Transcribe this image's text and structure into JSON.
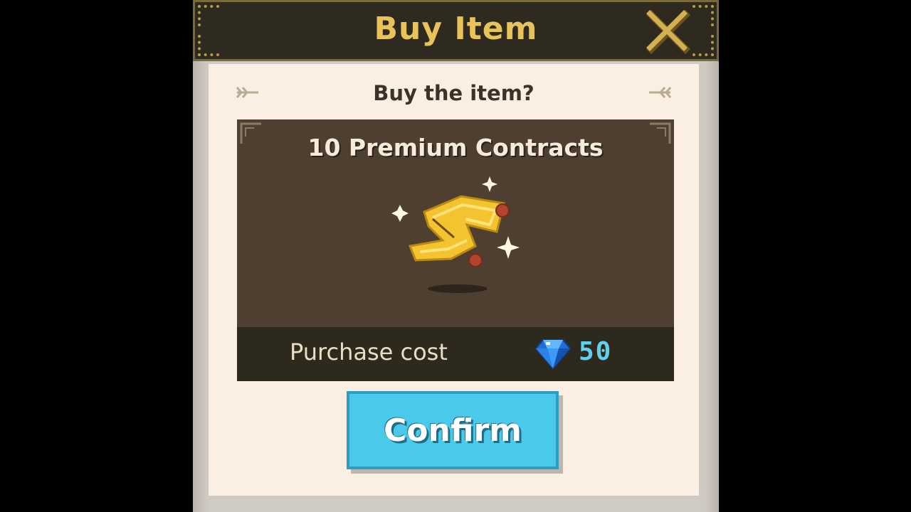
{
  "dialog": {
    "title": "Buy Item",
    "subtitle": "Buy the item?",
    "item_name": "10 Premium Contracts",
    "cost_label": "Purchase cost",
    "cost_value": "50",
    "confirm_label": "Confirm"
  },
  "icons": {
    "close": "close-icon",
    "gem": "gem-icon",
    "item": "contract-scroll-icon",
    "decoration": "arrow-ornament-icon"
  },
  "colors": {
    "title_gold": "#e8c35a",
    "panel_bg": "#fbeee2",
    "item_box_bg": "#4f3f31",
    "cost_bar_bg": "#2d2a1d",
    "gem_value": "#5fd0f0",
    "confirm_button": "#4bc9ea"
  }
}
